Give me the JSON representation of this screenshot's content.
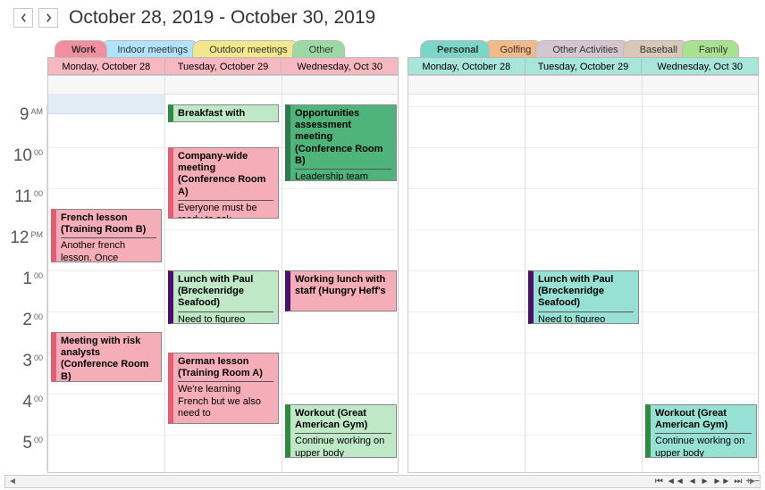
{
  "header": {
    "title": "October 28, 2019 - October 30, 2019"
  },
  "groups": {
    "work": {
      "tabs": [
        "Work",
        "Indoor meetings",
        "Outdoor meetings",
        "Other"
      ],
      "active_tab": 0,
      "days": [
        "Monday, October 28",
        "Tuesday, October 29",
        "Wednesday, Oct 30"
      ]
    },
    "personal": {
      "tabs": [
        "Personal",
        "Golfing",
        "Other Activities",
        "Baseball",
        "Family"
      ],
      "active_tab": 0,
      "days": [
        "Monday, October 28",
        "Tuesday, October 29",
        "Wednesday, Oct 30"
      ]
    }
  },
  "time_axis": [
    {
      "hour": "9",
      "suffix": "AM"
    },
    {
      "hour": "10",
      "suffix": "00"
    },
    {
      "hour": "11",
      "suffix": "00"
    },
    {
      "hour": "12",
      "suffix": "PM"
    },
    {
      "hour": "1",
      "suffix": "00"
    },
    {
      "hour": "2",
      "suffix": "00"
    },
    {
      "hour": "3",
      "suffix": "00"
    },
    {
      "hour": "4",
      "suffix": "00"
    },
    {
      "hour": "5",
      "suffix": "00"
    }
  ],
  "events": {
    "work": {
      "mon": [
        {
          "title": "French lesson (Training Room B)",
          "desc": "Another french lesson. Once"
        },
        {
          "title": "Meeting with risk analysts (Conference Room B)",
          "desc": ""
        }
      ],
      "tue": [
        {
          "title": "Breakfast with",
          "desc": ""
        },
        {
          "title": "Company-wide meeting (Conference Room A)",
          "desc": "Everyone must be ready to ask"
        },
        {
          "title": "Lunch with Paul (Breckenridge Seafood)",
          "desc": "Need to figureo"
        },
        {
          "title": "German lesson (Training Room A)",
          "desc": "We're learning French but we also need to"
        }
      ],
      "wed": [
        {
          "title": "Opportunities assessment meeting (Conference Room B)",
          "desc": "Leadership team"
        },
        {
          "title": "Working lunch with staff (Hungry Heff's",
          "desc": ""
        },
        {
          "title": "Workout (Great American Gym)",
          "desc": "Continue working on upper body"
        }
      ]
    },
    "personal": {
      "tue": [
        {
          "title": "Lunch with Paul (Breckenridge Seafood)",
          "desc": "Need to figureo"
        }
      ],
      "wed": [
        {
          "title": "Workout (Great American Gym)",
          "desc": "Continue working on upper body"
        }
      ]
    }
  }
}
